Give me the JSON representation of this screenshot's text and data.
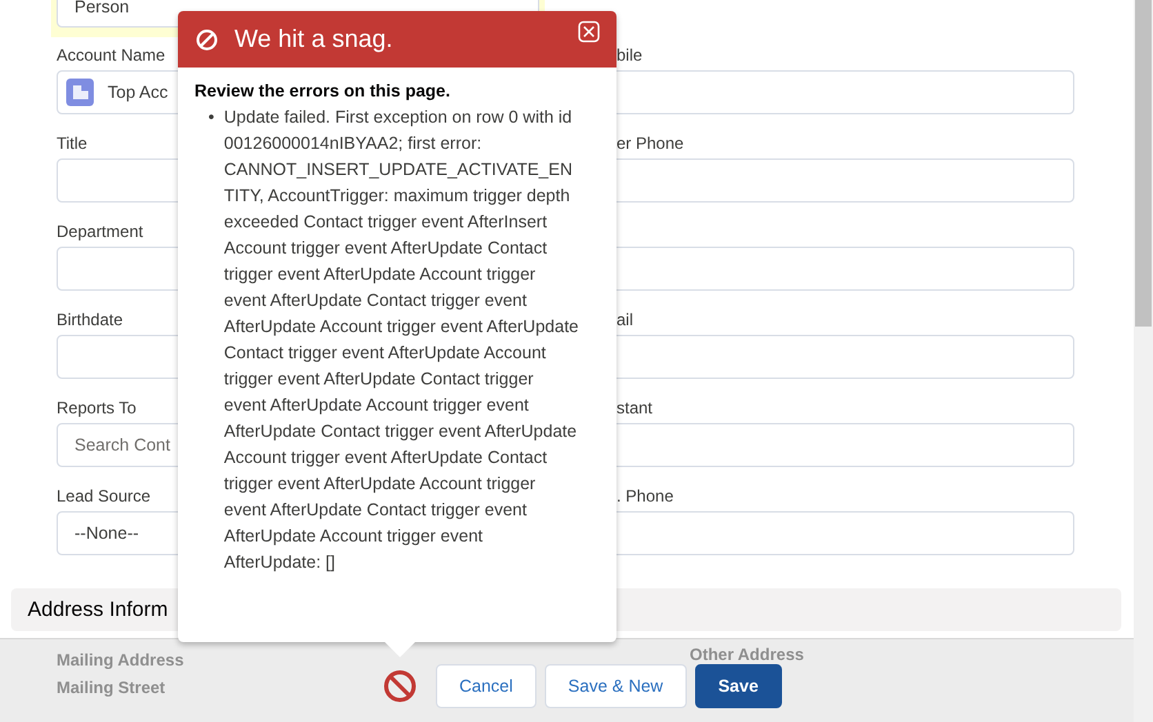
{
  "form": {
    "top_field": {
      "value": "Person",
      "highlighted": true
    },
    "rows": [
      {
        "left": {
          "kind": "lookup",
          "label": "Account Name",
          "value": "Top Acc"
        },
        "right": {
          "label": "bile"
        }
      },
      {
        "left": {
          "kind": "text",
          "label": "Title"
        },
        "right": {
          "label": "er Phone"
        }
      },
      {
        "left": {
          "kind": "text",
          "label": "Department"
        },
        "right": {}
      },
      {
        "left": {
          "kind": "text",
          "label": "Birthdate"
        },
        "right": {
          "label": "ail"
        }
      },
      {
        "left": {
          "kind": "search",
          "label": "Reports To",
          "placeholder": "Search Cont"
        },
        "right": {
          "label": "stant"
        }
      },
      {
        "left": {
          "kind": "select",
          "label": "Lead Source",
          "value": "--None--"
        },
        "right": {
          "label": ". Phone"
        }
      }
    ],
    "section": {
      "title": "Address Inform"
    },
    "below": {
      "left_title": "Mailing Address",
      "left_label": "Mailing Street",
      "right_title": "Other Address"
    }
  },
  "error_popup": {
    "title": "We hit a snag.",
    "heading": "Review the errors on this page.",
    "bullet": "•",
    "errors": [
      "Update failed. First exception on row 0 with id 00126000014nIBYAA2; first error: CANNOT_INSERT_UPDATE_ACTIVATE_ENTITY, AccountTrigger: maximum trigger depth exceeded Contact trigger event AfterInsert Account trigger event AfterUpdate Contact trigger event AfterUpdate Account trigger event AfterUpdate Contact trigger event AfterUpdate Account trigger event AfterUpdate Contact trigger event AfterUpdate Account trigger event AfterUpdate Contact trigger event AfterUpdate Account trigger event AfterUpdate Contact trigger event AfterUpdate Account trigger event AfterUpdate Contact trigger event AfterUpdate Account trigger event AfterUpdate Contact trigger event AfterUpdate Account trigger event AfterUpdate: []"
    ]
  },
  "footer": {
    "has_error": true,
    "buttons": [
      {
        "label": "Cancel",
        "kind": "neutral"
      },
      {
        "label": "Save & New",
        "kind": "neutral"
      },
      {
        "label": "Save",
        "kind": "brand"
      }
    ]
  }
}
